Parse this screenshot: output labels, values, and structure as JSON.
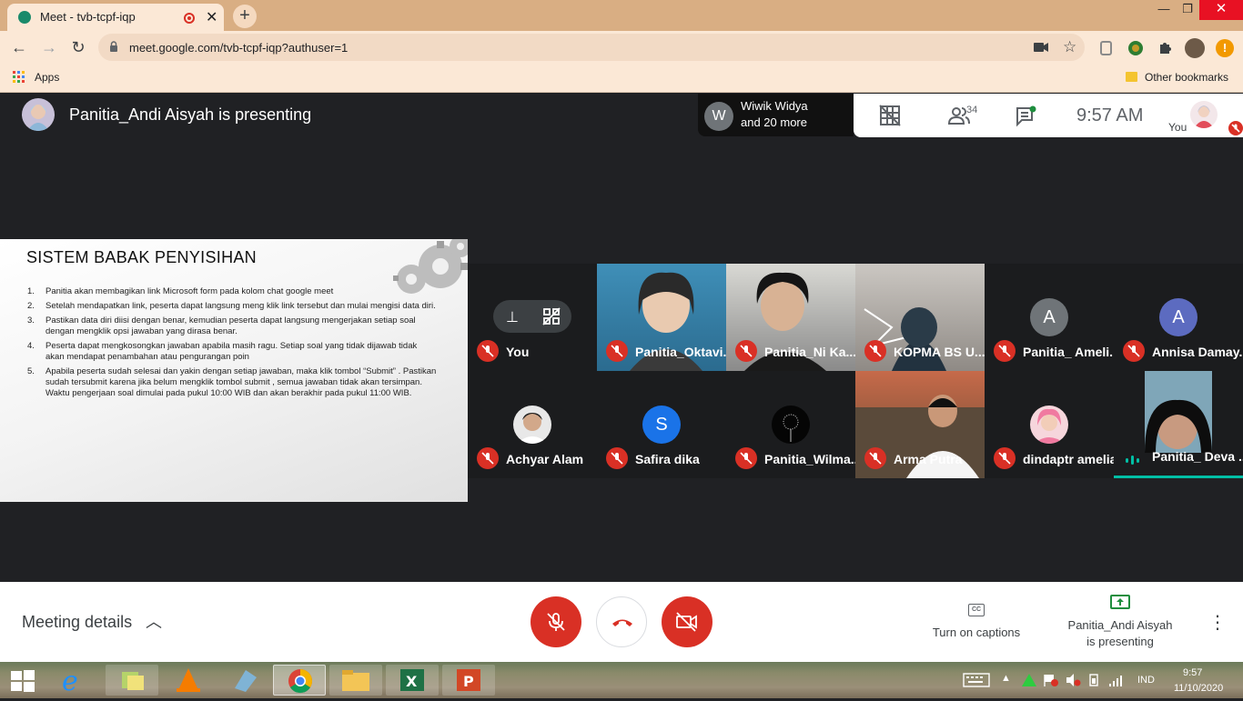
{
  "browser": {
    "tab_title": "Meet - tvb-tcpf-iqp",
    "url": "meet.google.com/tvb-tcpf-iqp?authuser=1",
    "apps_label": "Apps",
    "other_bookmarks": "Other bookmarks"
  },
  "meet": {
    "presenting_title": "Panitia_Andi Aisyah is presenting",
    "speaker_name": "Wiwik Widya",
    "speaker_more": "and 20 more",
    "speaker_initial": "W",
    "participant_count": "34",
    "clock": "9:57  AM",
    "you_label": "You",
    "slide": {
      "title": "SISTEM BABAK PENYISIHAN",
      "items": [
        "Panitia akan membagikan link Microsoft form pada kolom chat google meet",
        "Setelah mendapatkan link, peserta dapat langsung meng klik link tersebut dan mulai mengisi data diri.",
        "Pastikan data diri diisi dengan benar, kemudian peserta dapat langsung mengerjakan setiap soal dengan mengklik opsi jawaban yang dirasa benar.",
        "Peserta dapat mengkosongkan jawaban apabila masih ragu. Setiap soal yang tidak dijawab tidak akan mendapat penambahan atau pengurangan poin",
        "Apabila peserta sudah selesai dan yakin dengan setiap jawaban, maka klik tombol “Submit” . Pastikan sudah tersubmit karena jika belum mengklik tombol submit , semua jawaban tidak akan tersimpan. Waktu pengerjaan soal dimulai pada pukul 10:00 WIB dan akan berakhir pada pukul 11:00 WIB."
      ]
    },
    "participants": [
      {
        "name": "You",
        "initial": ""
      },
      {
        "name": "Panitia_Oktavi...",
        "initial": ""
      },
      {
        "name": "Panitia_Ni Ka...",
        "initial": ""
      },
      {
        "name": "KOPMA BS U...",
        "initial": ""
      },
      {
        "name": "Panitia_ Ameli...",
        "initial": "A"
      },
      {
        "name": "Annisa Damay...",
        "initial": "A"
      },
      {
        "name": "Achyar Alam",
        "initial": ""
      },
      {
        "name": "Safira dika",
        "initial": "S"
      },
      {
        "name": "Panitia_Wilma...",
        "initial": ""
      },
      {
        "name": "Arma Putra",
        "initial": ""
      },
      {
        "name": "dindaptr amelia",
        "initial": ""
      },
      {
        "name": "Panitia_ Deva ...",
        "initial": ""
      }
    ],
    "meeting_details": "Meeting details",
    "captions_label": "Turn on captions",
    "captions_icon_text": "CC",
    "presenting_line1": "Panitia_Andi Aisyah",
    "presenting_line2": "is presenting"
  },
  "taskbar": {
    "language": "IND",
    "time": "9:57",
    "date": "11/10/2020"
  },
  "colors": {
    "danger": "#d93025",
    "meet_bg": "#202124",
    "chrome_frame": "#d9ae83",
    "accent_green": "#1e8e3e"
  }
}
